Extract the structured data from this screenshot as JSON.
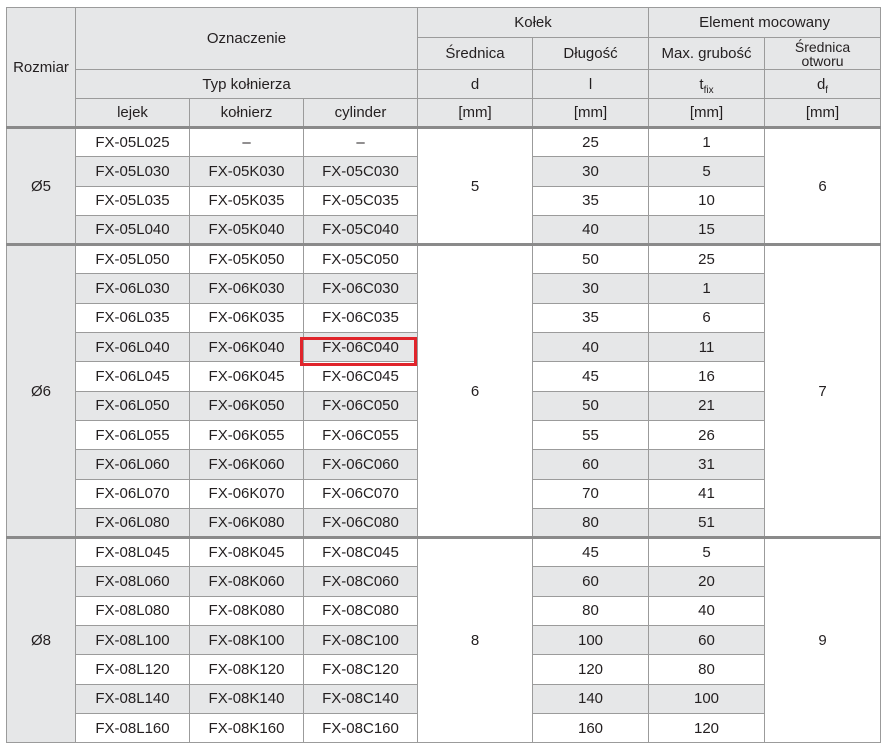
{
  "header": {
    "rozmiar": "Rozmiar",
    "oznaczenie": "Oznaczenie",
    "typ_kolnierza": "Typ kołnierza",
    "typ_lejek": "lejek",
    "typ_kolnierz": "kołnierz",
    "typ_cylinder": "cylinder",
    "kolek": "Kołek",
    "srednica": "Średnica",
    "dlugosc": "Długość",
    "element": "Element mocowany",
    "max_grubosc": "Max. grubość",
    "srednica_otworu_1": "Średnica",
    "srednica_otworu_2": "otworu",
    "sym_d": "d",
    "sym_l": "l",
    "sym_t": "t",
    "sym_t_sub": "fix",
    "sym_df": "d",
    "sym_df_sub": "f",
    "unit": "[mm]"
  },
  "groups": [
    {
      "size": "Ø5",
      "d": "5",
      "df": "6",
      "rows": [
        {
          "lejek": "FX-05L025",
          "kolnierz": "–",
          "cylinder": "–",
          "l": "25",
          "tfix": "1"
        },
        {
          "lejek": "FX-05L030",
          "kolnierz": "FX-05K030",
          "cylinder": "FX-05C030",
          "l": "30",
          "tfix": "5"
        },
        {
          "lejek": "FX-05L035",
          "kolnierz": "FX-05K035",
          "cylinder": "FX-05C035",
          "l": "35",
          "tfix": "10"
        },
        {
          "lejek": "FX-05L040",
          "kolnierz": "FX-05K040",
          "cylinder": "FX-05C040",
          "l": "40",
          "tfix": "15"
        }
      ]
    },
    {
      "size": "Ø6",
      "d": "6",
      "df": "7",
      "rows": [
        {
          "lejek": "FX-05L050",
          "kolnierz": "FX-05K050",
          "cylinder": "FX-05C050",
          "l": "50",
          "tfix": "25"
        },
        {
          "lejek": "FX-06L030",
          "kolnierz": "FX-06K030",
          "cylinder": "FX-06C030",
          "l": "30",
          "tfix": "1"
        },
        {
          "lejek": "FX-06L035",
          "kolnierz": "FX-06K035",
          "cylinder": "FX-06C035",
          "l": "35",
          "tfix": "6"
        },
        {
          "lejek": "FX-06L040",
          "kolnierz": "FX-06K040",
          "cylinder": "FX-06C040",
          "l": "40",
          "tfix": "11"
        },
        {
          "lejek": "FX-06L045",
          "kolnierz": "FX-06K045",
          "cylinder": "FX-06C045",
          "l": "45",
          "tfix": "16"
        },
        {
          "lejek": "FX-06L050",
          "kolnierz": "FX-06K050",
          "cylinder": "FX-06C050",
          "l": "50",
          "tfix": "21"
        },
        {
          "lejek": "FX-06L055",
          "kolnierz": "FX-06K055",
          "cylinder": "FX-06C055",
          "l": "55",
          "tfix": "26"
        },
        {
          "lejek": "FX-06L060",
          "kolnierz": "FX-06K060",
          "cylinder": "FX-06C060",
          "l": "60",
          "tfix": "31"
        },
        {
          "lejek": "FX-06L070",
          "kolnierz": "FX-06K070",
          "cylinder": "FX-06C070",
          "l": "70",
          "tfix": "41"
        },
        {
          "lejek": "FX-06L080",
          "kolnierz": "FX-06K080",
          "cylinder": "FX-06C080",
          "l": "80",
          "tfix": "51"
        }
      ]
    },
    {
      "size": "Ø8",
      "d": "8",
      "df": "9",
      "rows": [
        {
          "lejek": "FX-08L045",
          "kolnierz": "FX-08K045",
          "cylinder": "FX-08C045",
          "l": "45",
          "tfix": "5"
        },
        {
          "lejek": "FX-08L060",
          "kolnierz": "FX-08K060",
          "cylinder": "FX-08C060",
          "l": "60",
          "tfix": "20"
        },
        {
          "lejek": "FX-08L080",
          "kolnierz": "FX-08K080",
          "cylinder": "FX-08C080",
          "l": "80",
          "tfix": "40"
        },
        {
          "lejek": "FX-08L100",
          "kolnierz": "FX-08K100",
          "cylinder": "FX-08C100",
          "l": "100",
          "tfix": "60"
        },
        {
          "lejek": "FX-08L120",
          "kolnierz": "FX-08K120",
          "cylinder": "FX-08C120",
          "l": "120",
          "tfix": "80"
        },
        {
          "lejek": "FX-08L140",
          "kolnierz": "FX-08K140",
          "cylinder": "FX-08C140",
          "l": "140",
          "tfix": "100"
        },
        {
          "lejek": "FX-08L160",
          "kolnierz": "FX-08K160",
          "cylinder": "FX-08C160",
          "l": "160",
          "tfix": "120"
        }
      ]
    }
  ],
  "highlight": {
    "cell": "FX-06C040",
    "color": "#e0242b"
  }
}
